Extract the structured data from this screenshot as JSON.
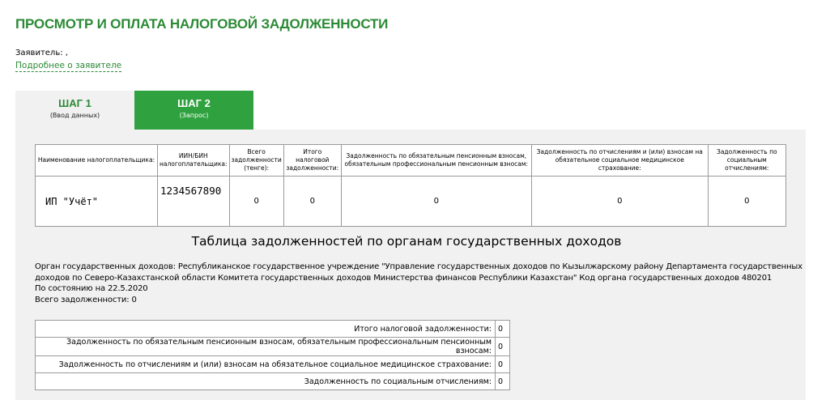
{
  "page": {
    "title": "ПРОСМОТР И ОПЛАТА НАЛОГОВОЙ ЗАДОЛЖЕННОСТИ"
  },
  "applicant": {
    "label": "Заявитель: ,",
    "details_link": "Подробнее о заявителе"
  },
  "steps": [
    {
      "title": "ШАГ 1",
      "subtitle": "(Ввод данных)",
      "active": false
    },
    {
      "title": "ШАГ 2",
      "subtitle": "(Запрос)",
      "active": true
    }
  ],
  "colors": {
    "accent": "#2b8a35",
    "active_tab": "#2fa23f",
    "panel": "#f1f1f1",
    "border": "#9a9a9a"
  },
  "taxpayer_table": {
    "headers": [
      "Наименование налогоплательщика:",
      "ИИН/БИН налогоплательщика:",
      "Всего задолженности (тенге):",
      "Итого налоговой задолженности:",
      "Задолженность по обязательным пенсионным взносам, обязательным профессиональным пенсионным взносам:",
      "Задолженность по отчислениям и (или) взносам на обязательное социальное медицинское страхование:",
      "Задолженность по социальным отчислениям:"
    ],
    "row": [
      "ИП \"Учёт\"",
      "1234567890",
      "0",
      "0",
      "0",
      "0",
      "0"
    ]
  },
  "section": {
    "title": "Таблица задолженностей по органам государственных доходов",
    "org_line1": "Орган государственных доходов: Республиканское государственное учреждение \"Управление государственных доходов по Кызылжарскому району Департамента государственных",
    "org_line2": "доходов по Северо-Казахстанской области Комитета государственных доходов Министерства финансов Республики Казахстан\" Код органа государственных доходов 480201",
    "as_of": "По состоянию на 22.5.2020",
    "total": "Всего задолженности: 0"
  },
  "summary_table": [
    {
      "label": "Итого налоговой задолженности:",
      "value": "0"
    },
    {
      "label": "Задолженность по обязательным пенсионным взносам, обязательным профессиональным пенсионным взносам:",
      "value": "0"
    },
    {
      "label": "Задолженность по отчислениям и (или) взносам на обязательное социальное медицинское страхование:",
      "value": "0"
    },
    {
      "label": "Задолженность по социальным отчислениям:",
      "value": "0"
    }
  ]
}
